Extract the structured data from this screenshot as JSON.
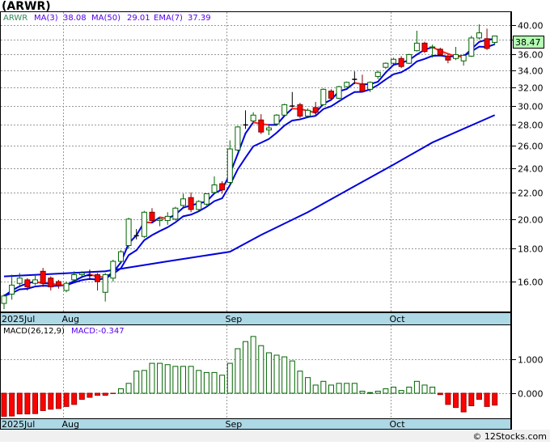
{
  "title": "(ARWR)",
  "legend": {
    "symbol": "ARWR",
    "ma3_label": "MA(3)",
    "ma3_value": "38.08",
    "ma50_label": "MA(50)",
    "ma50_value": "29.01",
    "ema7_label": "EMA(7)",
    "ema7_value": "37.39"
  },
  "macd_legend": {
    "label": "MACD(26,12,9)",
    "value": "MACD:-0.347"
  },
  "last_price": "38.47",
  "footer": "© 12Stocks.com",
  "x_labels": [
    "2025Jul",
    "Aug",
    "Sep",
    "Oct"
  ],
  "colors": {
    "up": "#006400",
    "down": "#ff0000",
    "ma": "#0000dd",
    "band": "#add8e6",
    "price_box": "#b3ffb3"
  },
  "chart_data": [
    {
      "type": "candlestick",
      "title": "ARWR",
      "scale": "log",
      "ylim": [
        14.4,
        41.2
      ],
      "y_ticks": [
        "40.00",
        "38.00",
        "36.00",
        "34.00",
        "32.00",
        "30.00",
        "28.00",
        "26.00",
        "24.00",
        "22.00",
        "20.00",
        "18.00",
        "16.00"
      ],
      "x_ticks": [
        {
          "label": "2025Jul",
          "index": 0
        },
        {
          "label": "Aug",
          "index": 8
        },
        {
          "label": "Sep",
          "index": 29
        },
        {
          "label": "Oct",
          "index": 50
        }
      ],
      "ohlc": [
        [
          14.8,
          15.3,
          14.5,
          15.2
        ],
        [
          15.3,
          16.4,
          15.0,
          15.8
        ],
        [
          15.9,
          16.5,
          15.8,
          16.2
        ],
        [
          16.1,
          16.2,
          15.5,
          15.7
        ],
        [
          15.9,
          16.4,
          15.8,
          16.1
        ],
        [
          16.6,
          16.8,
          15.7,
          15.9
        ],
        [
          16.2,
          16.3,
          15.5,
          15.7
        ],
        [
          16.0,
          16.1,
          15.6,
          15.8
        ],
        [
          15.5,
          16.0,
          15.4,
          15.9
        ],
        [
          16.1,
          16.6,
          16.0,
          16.4
        ],
        [
          16.4,
          16.6,
          16.3,
          16.5
        ],
        [
          16.3,
          16.7,
          16.1,
          16.35
        ],
        [
          16.4,
          16.5,
          15.5,
          16.0
        ],
        [
          15.4,
          16.5,
          14.9,
          16.4
        ],
        [
          16.2,
          17.3,
          16.0,
          17.2
        ],
        [
          17.2,
          17.9,
          17.1,
          17.8
        ],
        [
          18.2,
          20.1,
          18.0,
          20.0
        ],
        [
          18.8,
          19.3,
          18.6,
          18.85
        ],
        [
          18.8,
          20.6,
          18.7,
          20.5
        ],
        [
          20.5,
          20.8,
          19.8,
          19.9
        ],
        [
          19.9,
          20.1,
          19.5,
          20.0
        ],
        [
          19.9,
          20.5,
          19.6,
          20.2
        ],
        [
          20.0,
          20.9,
          19.9,
          20.8
        ],
        [
          21.0,
          21.9,
          20.9,
          21.5
        ],
        [
          21.6,
          22.0,
          20.5,
          20.7
        ],
        [
          20.7,
          21.4,
          20.6,
          21.3
        ],
        [
          21.1,
          21.9,
          21.0,
          21.9
        ],
        [
          22.0,
          23.3,
          21.9,
          22.6
        ],
        [
          22.7,
          22.9,
          21.9,
          22.2
        ],
        [
          22.8,
          26.5,
          22.5,
          25.7
        ],
        [
          25.6,
          27.9,
          25.5,
          27.8
        ],
        [
          28.0,
          29.5,
          27.6,
          28.0
        ],
        [
          28.4,
          29.3,
          28.2,
          29.0
        ],
        [
          28.5,
          29.1,
          27.1,
          27.3
        ],
        [
          27.5,
          27.9,
          27.0,
          27.7
        ],
        [
          28.1,
          29.1,
          28.0,
          29.0
        ],
        [
          29.0,
          30.2,
          28.9,
          30.1
        ],
        [
          29.9,
          31.5,
          29.8,
          29.95
        ],
        [
          30.1,
          30.3,
          28.7,
          28.9
        ],
        [
          28.9,
          29.7,
          28.8,
          29.5
        ],
        [
          29.8,
          30.4,
          28.9,
          29.3
        ],
        [
          30.1,
          31.9,
          30.0,
          31.8
        ],
        [
          31.6,
          31.8,
          30.6,
          30.8
        ],
        [
          30.8,
          32.2,
          30.7,
          32.1
        ],
        [
          32.1,
          32.7,
          32.0,
          32.6
        ],
        [
          32.9,
          33.9,
          32.4,
          32.95
        ],
        [
          32.4,
          33.5,
          31.5,
          31.6
        ],
        [
          31.8,
          32.7,
          31.5,
          32.6
        ],
        [
          33.3,
          34.0,
          33.0,
          33.8
        ],
        [
          34.4,
          35.0,
          34.2,
          34.9
        ],
        [
          34.9,
          35.6,
          34.8,
          35.4
        ],
        [
          35.5,
          35.8,
          34.3,
          34.5
        ],
        [
          34.9,
          36.1,
          34.8,
          36.0
        ],
        [
          36.5,
          39.2,
          36.4,
          37.5
        ],
        [
          37.5,
          37.7,
          36.2,
          36.4
        ],
        [
          36.9,
          37.3,
          35.6,
          37.0
        ],
        [
          36.7,
          36.9,
          35.9,
          36.0
        ],
        [
          35.8,
          36.0,
          34.9,
          35.3
        ],
        [
          35.5,
          37.0,
          35.3,
          36.0
        ],
        [
          35.2,
          36.1,
          34.6,
          35.9
        ],
        [
          35.8,
          38.5,
          35.7,
          38.2
        ],
        [
          38.2,
          40.1,
          38.0,
          38.9
        ],
        [
          38.1,
          39.5,
          36.6,
          36.8
        ],
        [
          37.6,
          38.5,
          37.3,
          38.47
        ]
      ],
      "ma50_points": [
        [
          0,
          16.3
        ],
        [
          13,
          16.6
        ],
        [
          21,
          17.2
        ],
        [
          29,
          17.8
        ],
        [
          33,
          18.9
        ],
        [
          39,
          20.5
        ],
        [
          45,
          22.5
        ],
        [
          50,
          24.3
        ],
        [
          55,
          26.3
        ],
        [
          63,
          29.0
        ]
      ]
    },
    {
      "type": "bar",
      "title": "MACD(26,12,9)",
      "ylim": [
        -0.75,
        2.0
      ],
      "y_ticks": [
        "1.000",
        "0.000"
      ],
      "values": [
        -0.68,
        -0.67,
        -0.61,
        -0.61,
        -0.6,
        -0.51,
        -0.47,
        -0.45,
        -0.39,
        -0.33,
        -0.18,
        -0.12,
        -0.06,
        -0.06,
        -0.01,
        0.13,
        0.29,
        0.65,
        0.67,
        0.88,
        0.88,
        0.84,
        0.79,
        0.79,
        0.79,
        0.67,
        0.61,
        0.61,
        0.53,
        0.88,
        1.31,
        1.52,
        1.67,
        1.4,
        1.19,
        1.12,
        1.07,
        0.95,
        0.65,
        0.46,
        0.24,
        0.35,
        0.24,
        0.29,
        0.29,
        0.29,
        0.06,
        0.02,
        0.06,
        0.13,
        0.18,
        0.08,
        0.18,
        0.35,
        0.24,
        0.18,
        -0.04,
        -0.33,
        -0.42,
        -0.55,
        -0.37,
        -0.18,
        -0.39,
        -0.35
      ]
    }
  ]
}
